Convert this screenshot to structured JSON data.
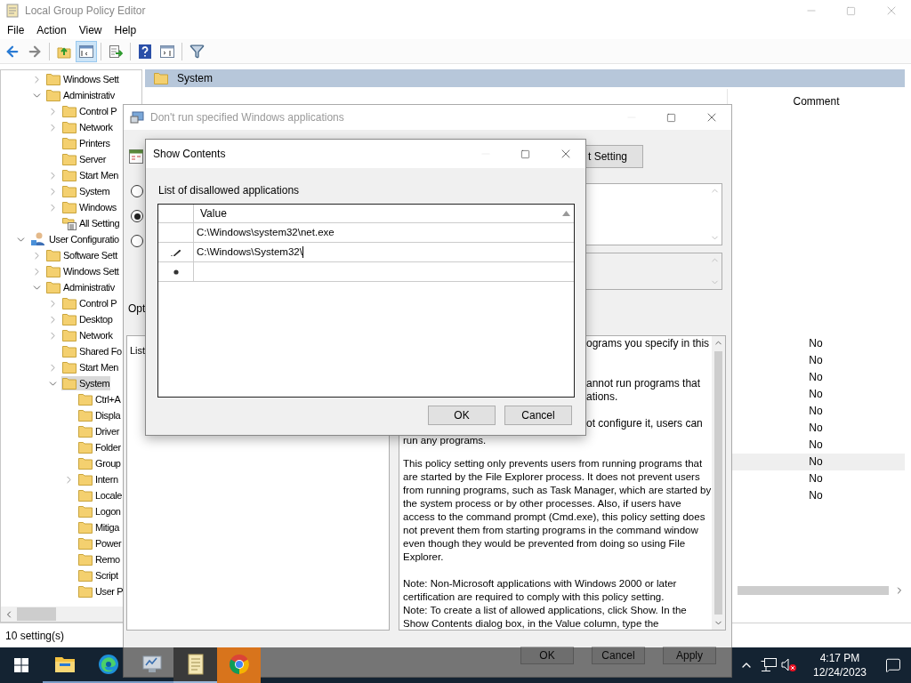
{
  "main_window": {
    "title": "Local Group Policy Editor",
    "menu": [
      "File",
      "Action",
      "View",
      "Help"
    ],
    "toolbar": [
      {
        "kind": "back",
        "pressed": false
      },
      {
        "kind": "forward",
        "pressed": false
      },
      {
        "kind": "separator"
      },
      {
        "kind": "up",
        "pressed": false
      },
      {
        "kind": "tree",
        "pressed": true
      },
      {
        "kind": "separator"
      },
      {
        "kind": "export",
        "pressed": false
      },
      {
        "kind": "separator"
      },
      {
        "kind": "help",
        "pressed": false
      },
      {
        "kind": "action-pane",
        "pressed": false
      },
      {
        "kind": "separator"
      },
      {
        "kind": "filter",
        "pressed": false
      }
    ],
    "tree": {
      "scrolled_branch_children": [
        {
          "label": "Windows Sett",
          "kind": "folder",
          "expanded": false,
          "selected": false
        },
        {
          "label": "Administrativ",
          "kind": "folder",
          "expanded": true,
          "selected": false,
          "children": [
            {
              "label": "Control P",
              "kind": "folder",
              "expanded": false,
              "selected": false
            },
            {
              "label": "Network",
              "kind": "folder",
              "expanded": false,
              "selected": false
            },
            {
              "label": "Printers",
              "kind": "folder",
              "selected": false
            },
            {
              "label": "Server",
              "kind": "folder",
              "selected": false
            },
            {
              "label": "Start Men",
              "kind": "folder",
              "expanded": false,
              "selected": false
            },
            {
              "label": "System",
              "kind": "folder",
              "expanded": false,
              "selected": false
            },
            {
              "label": "Windows",
              "kind": "folder",
              "expanded": false,
              "selected": false
            },
            {
              "label": "All Setting",
              "kind": "all-settings",
              "selected": false
            }
          ]
        }
      ],
      "roots": [
        {
          "label": "User Configuratio",
          "kind": "user",
          "expanded": true,
          "selected": false,
          "children": [
            {
              "label": "Software Sett",
              "kind": "folder",
              "expanded": false,
              "selected": false
            },
            {
              "label": "Windows Sett",
              "kind": "folder",
              "expanded": false,
              "selected": false
            },
            {
              "label": "Administrativ",
              "kind": "folder",
              "expanded": true,
              "selected": false,
              "children": [
                {
                  "label": "Control P",
                  "kind": "folder",
                  "expanded": false,
                  "selected": false
                },
                {
                  "label": "Desktop",
                  "kind": "folder",
                  "expanded": false,
                  "selected": false
                },
                {
                  "label": "Network",
                  "kind": "folder",
                  "expanded": false,
                  "selected": false
                },
                {
                  "label": "Shared Fo",
                  "kind": "folder",
                  "selected": false
                },
                {
                  "label": "Start Men",
                  "kind": "folder",
                  "expanded": false,
                  "selected": false
                },
                {
                  "label": "System",
                  "kind": "folder",
                  "expanded": true,
                  "selected": true,
                  "children": [
                    {
                      "label": "Ctrl+A",
                      "kind": "folder",
                      "selected": false
                    },
                    {
                      "label": "Displa",
                      "kind": "folder",
                      "selected": false
                    },
                    {
                      "label": "Driver",
                      "kind": "folder",
                      "selected": false
                    },
                    {
                      "label": "Folder",
                      "kind": "folder",
                      "selected": false
                    },
                    {
                      "label": "Group",
                      "kind": "folder",
                      "selected": false
                    },
                    {
                      "label": "Intern",
                      "kind": "folder",
                      "expanded": false,
                      "selected": false
                    },
                    {
                      "label": "Locale",
                      "kind": "folder",
                      "selected": false
                    },
                    {
                      "label": "Logon",
                      "kind": "folder",
                      "selected": false
                    },
                    {
                      "label": "Mitiga",
                      "kind": "folder",
                      "selected": false
                    },
                    {
                      "label": "Power",
                      "kind": "folder",
                      "selected": false
                    },
                    {
                      "label": "Remo",
                      "kind": "folder",
                      "selected": false
                    },
                    {
                      "label": "Script",
                      "kind": "folder",
                      "selected": false
                    },
                    {
                      "label": "User P",
                      "kind": "folder",
                      "selected": false
                    }
                  ]
                }
              ]
            }
          ]
        }
      ]
    },
    "details": {
      "folder_title": "System",
      "column_header": "Comment",
      "rows": [
        {
          "comment": "No",
          "selected": false
        },
        {
          "comment": "No",
          "selected": false
        },
        {
          "comment": "No",
          "selected": false
        },
        {
          "comment": "No",
          "selected": false
        },
        {
          "comment": "No",
          "selected": false
        },
        {
          "comment": "No",
          "selected": false
        },
        {
          "comment": "No",
          "selected": false
        },
        {
          "comment": "No",
          "selected": true
        },
        {
          "comment": "No",
          "selected": false
        },
        {
          "comment": "No",
          "selected": false
        }
      ]
    },
    "status_bar": "10 setting(s)"
  },
  "policy_dialog": {
    "title": "Don't run specified Windows applications",
    "nav_button": "t Setting",
    "radios": [
      {
        "selected": false
      },
      {
        "selected": true
      },
      {
        "selected": false
      }
    ],
    "options_label": "Opt",
    "options_text": "List",
    "help_fragments": [
      [
        "ograms you specify in this"
      ],
      [
        "annot run programs that",
        "ations."
      ],
      [
        "ot configure it, users can"
      ]
    ],
    "help_paragraphs": [
      "run any programs.",
      "This policy setting only prevents users from running programs that are started by the File Explorer process. It does not prevent users from running programs, such as Task Manager, which are started by the system process or by other processes.  Also, if users have access to the command prompt (Cmd.exe), this policy setting does not prevent them from starting programs in the command window even though they would be prevented from doing so using File Explorer.",
      "Note: Non-Microsoft applications with Windows 2000 or later certification are required to comply with this policy setting.\nNote: To create a list of allowed applications, click Show.  In the Show Contents dialog box, in the Value column, type the"
    ],
    "buttons": [
      "OK",
      "Cancel",
      "Apply"
    ]
  },
  "show_contents": {
    "title": "Show Contents",
    "label": "List of disallowed applications",
    "column": "Value",
    "rows": [
      {
        "kind": "plain",
        "value": "C:\\Windows\\system32\\net.exe"
      },
      {
        "kind": "editing",
        "value": "C:\\Windows\\System32\\"
      },
      {
        "kind": "new"
      }
    ],
    "buttons": [
      "OK",
      "Cancel"
    ]
  },
  "taskbar": {
    "apps": [
      {
        "kind": "explorer",
        "focused": false,
        "flashing": false
      },
      {
        "kind": "edge",
        "focused": false,
        "flashing": false
      },
      {
        "kind": "server",
        "focused": false,
        "flashing": false
      },
      {
        "kind": "gpedit",
        "focused": true,
        "flashing": false
      },
      {
        "kind": "chrome",
        "focused": false,
        "flashing": true
      }
    ],
    "volume_muted": true,
    "time": "4:17 PM",
    "date": "12/24/2023"
  }
}
